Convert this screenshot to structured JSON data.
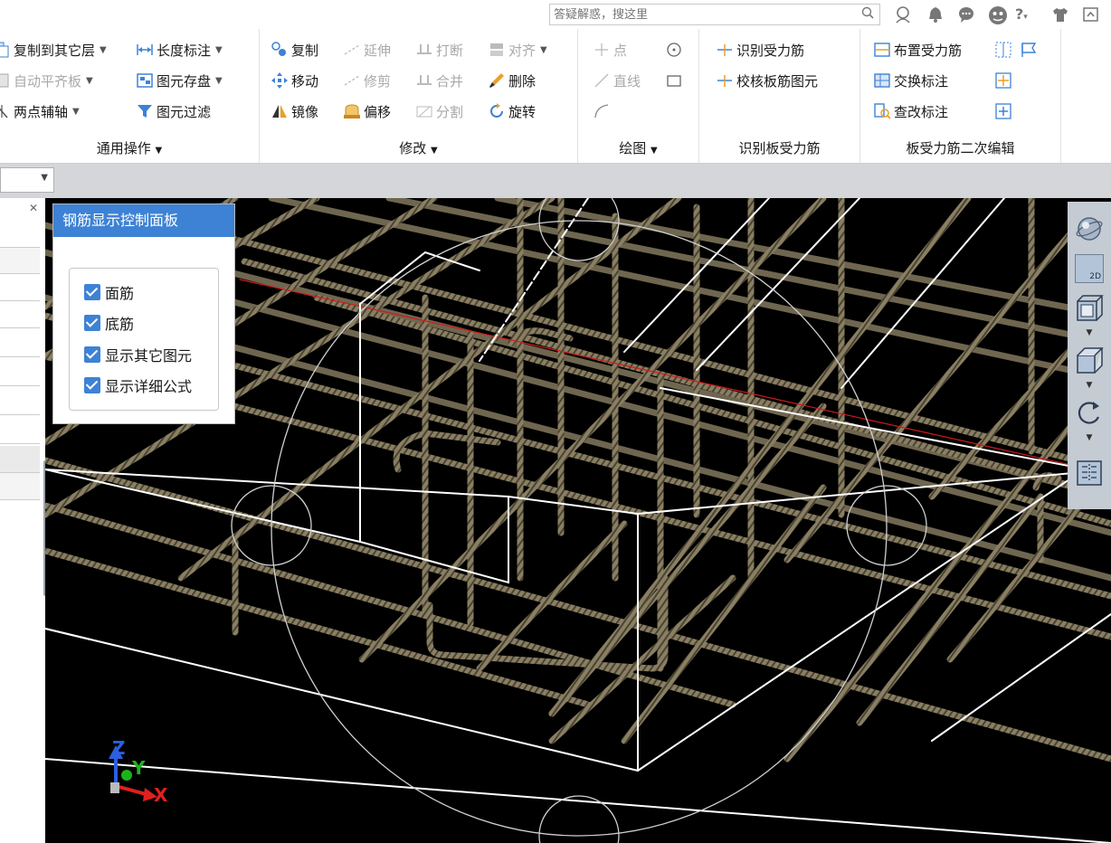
{
  "search": {
    "placeholder": "答疑解惑，搜这里"
  },
  "title_icons": [
    "search-icon",
    "user-icon",
    "bell-icon",
    "chat-icon",
    "avatar-icon",
    "help-icon",
    "shirt-icon",
    "restore-icon"
  ],
  "help_mark": "?",
  "ribbon": {
    "general": {
      "title": "通用操作",
      "copy_to_layer": "复制到其它层",
      "auto_align": "自动平齐板",
      "two_point_axis": "两点辅轴",
      "length_dim": "长度标注",
      "save_element": "图元存盘",
      "filter": "图元过滤"
    },
    "modify": {
      "title": "修改",
      "copy": "复制",
      "extend": "延伸",
      "break": "打断",
      "align": "对齐",
      "move": "移动",
      "trim": "修剪",
      "merge": "合并",
      "delete": "删除",
      "mirror": "镜像",
      "offset": "偏移",
      "split": "分割",
      "rotate": "旋转"
    },
    "draw": {
      "title": "绘图",
      "point": "点",
      "line": "直线"
    },
    "identify": {
      "title": "识别板受力筋",
      "identify_rebar": "识别受力筋",
      "check_rebar": "校核板筋图元"
    },
    "edit": {
      "title": "板受力筋二次编辑",
      "place_rebar": "布置受力筋",
      "swap_label": "交换标注",
      "check_label": "查改标注"
    }
  },
  "control_panel": {
    "title": "钢筋显示控制面板",
    "items": [
      {
        "label": "面筋",
        "checked": true
      },
      {
        "label": "底筋",
        "checked": true
      },
      {
        "label": "显示其它图元",
        "checked": true
      },
      {
        "label": "显示详细公式",
        "checked": true
      }
    ]
  },
  "nav": {
    "view_2d": "2D"
  },
  "axes": {
    "x": "X",
    "y": "Y",
    "z": "Z"
  },
  "colors": {
    "accent": "#3d82d5",
    "viewport_bg": "#000000",
    "rebar": "#8a7f62",
    "axis_x": "#e0201e",
    "axis_y": "#1db21d",
    "axis_z": "#2c5fe0"
  }
}
